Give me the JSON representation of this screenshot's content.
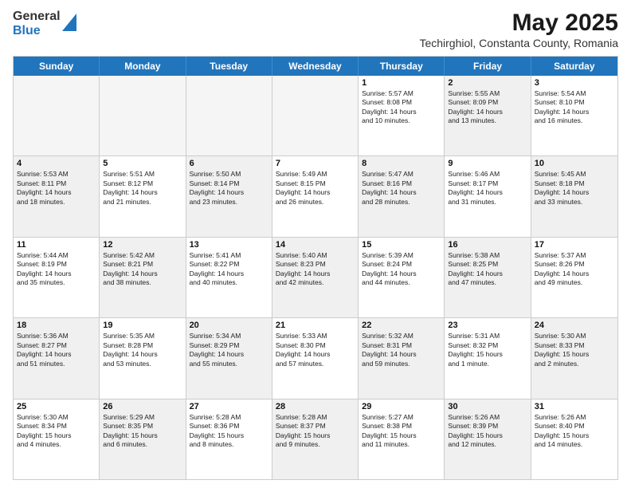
{
  "header": {
    "logo_line1": "General",
    "logo_line2": "Blue",
    "month_year": "May 2025",
    "location": "Techirghiol, Constanta County, Romania"
  },
  "days_of_week": [
    "Sunday",
    "Monday",
    "Tuesday",
    "Wednesday",
    "Thursday",
    "Friday",
    "Saturday"
  ],
  "weeks": [
    [
      {
        "day": "",
        "text": "",
        "empty": true
      },
      {
        "day": "",
        "text": "",
        "empty": true
      },
      {
        "day": "",
        "text": "",
        "empty": true
      },
      {
        "day": "",
        "text": "",
        "empty": true
      },
      {
        "day": "1",
        "text": "Sunrise: 5:57 AM\nSunset: 8:08 PM\nDaylight: 14 hours\nand 10 minutes.",
        "empty": false
      },
      {
        "day": "2",
        "text": "Sunrise: 5:55 AM\nSunset: 8:09 PM\nDaylight: 14 hours\nand 13 minutes.",
        "empty": false,
        "shaded": true
      },
      {
        "day": "3",
        "text": "Sunrise: 5:54 AM\nSunset: 8:10 PM\nDaylight: 14 hours\nand 16 minutes.",
        "empty": false
      }
    ],
    [
      {
        "day": "4",
        "text": "Sunrise: 5:53 AM\nSunset: 8:11 PM\nDaylight: 14 hours\nand 18 minutes.",
        "empty": false,
        "shaded": true
      },
      {
        "day": "5",
        "text": "Sunrise: 5:51 AM\nSunset: 8:12 PM\nDaylight: 14 hours\nand 21 minutes.",
        "empty": false
      },
      {
        "day": "6",
        "text": "Sunrise: 5:50 AM\nSunset: 8:14 PM\nDaylight: 14 hours\nand 23 minutes.",
        "empty": false,
        "shaded": true
      },
      {
        "day": "7",
        "text": "Sunrise: 5:49 AM\nSunset: 8:15 PM\nDaylight: 14 hours\nand 26 minutes.",
        "empty": false
      },
      {
        "day": "8",
        "text": "Sunrise: 5:47 AM\nSunset: 8:16 PM\nDaylight: 14 hours\nand 28 minutes.",
        "empty": false,
        "shaded": true
      },
      {
        "day": "9",
        "text": "Sunrise: 5:46 AM\nSunset: 8:17 PM\nDaylight: 14 hours\nand 31 minutes.",
        "empty": false
      },
      {
        "day": "10",
        "text": "Sunrise: 5:45 AM\nSunset: 8:18 PM\nDaylight: 14 hours\nand 33 minutes.",
        "empty": false,
        "shaded": true
      }
    ],
    [
      {
        "day": "11",
        "text": "Sunrise: 5:44 AM\nSunset: 8:19 PM\nDaylight: 14 hours\nand 35 minutes.",
        "empty": false
      },
      {
        "day": "12",
        "text": "Sunrise: 5:42 AM\nSunset: 8:21 PM\nDaylight: 14 hours\nand 38 minutes.",
        "empty": false,
        "shaded": true
      },
      {
        "day": "13",
        "text": "Sunrise: 5:41 AM\nSunset: 8:22 PM\nDaylight: 14 hours\nand 40 minutes.",
        "empty": false
      },
      {
        "day": "14",
        "text": "Sunrise: 5:40 AM\nSunset: 8:23 PM\nDaylight: 14 hours\nand 42 minutes.",
        "empty": false,
        "shaded": true
      },
      {
        "day": "15",
        "text": "Sunrise: 5:39 AM\nSunset: 8:24 PM\nDaylight: 14 hours\nand 44 minutes.",
        "empty": false
      },
      {
        "day": "16",
        "text": "Sunrise: 5:38 AM\nSunset: 8:25 PM\nDaylight: 14 hours\nand 47 minutes.",
        "empty": false,
        "shaded": true
      },
      {
        "day": "17",
        "text": "Sunrise: 5:37 AM\nSunset: 8:26 PM\nDaylight: 14 hours\nand 49 minutes.",
        "empty": false
      }
    ],
    [
      {
        "day": "18",
        "text": "Sunrise: 5:36 AM\nSunset: 8:27 PM\nDaylight: 14 hours\nand 51 minutes.",
        "empty": false,
        "shaded": true
      },
      {
        "day": "19",
        "text": "Sunrise: 5:35 AM\nSunset: 8:28 PM\nDaylight: 14 hours\nand 53 minutes.",
        "empty": false
      },
      {
        "day": "20",
        "text": "Sunrise: 5:34 AM\nSunset: 8:29 PM\nDaylight: 14 hours\nand 55 minutes.",
        "empty": false,
        "shaded": true
      },
      {
        "day": "21",
        "text": "Sunrise: 5:33 AM\nSunset: 8:30 PM\nDaylight: 14 hours\nand 57 minutes.",
        "empty": false
      },
      {
        "day": "22",
        "text": "Sunrise: 5:32 AM\nSunset: 8:31 PM\nDaylight: 14 hours\nand 59 minutes.",
        "empty": false,
        "shaded": true
      },
      {
        "day": "23",
        "text": "Sunrise: 5:31 AM\nSunset: 8:32 PM\nDaylight: 15 hours\nand 1 minute.",
        "empty": false
      },
      {
        "day": "24",
        "text": "Sunrise: 5:30 AM\nSunset: 8:33 PM\nDaylight: 15 hours\nand 2 minutes.",
        "empty": false,
        "shaded": true
      }
    ],
    [
      {
        "day": "25",
        "text": "Sunrise: 5:30 AM\nSunset: 8:34 PM\nDaylight: 15 hours\nand 4 minutes.",
        "empty": false
      },
      {
        "day": "26",
        "text": "Sunrise: 5:29 AM\nSunset: 8:35 PM\nDaylight: 15 hours\nand 6 minutes.",
        "empty": false,
        "shaded": true
      },
      {
        "day": "27",
        "text": "Sunrise: 5:28 AM\nSunset: 8:36 PM\nDaylight: 15 hours\nand 8 minutes.",
        "empty": false
      },
      {
        "day": "28",
        "text": "Sunrise: 5:28 AM\nSunset: 8:37 PM\nDaylight: 15 hours\nand 9 minutes.",
        "empty": false,
        "shaded": true
      },
      {
        "day": "29",
        "text": "Sunrise: 5:27 AM\nSunset: 8:38 PM\nDaylight: 15 hours\nand 11 minutes.",
        "empty": false
      },
      {
        "day": "30",
        "text": "Sunrise: 5:26 AM\nSunset: 8:39 PM\nDaylight: 15 hours\nand 12 minutes.",
        "empty": false,
        "shaded": true
      },
      {
        "day": "31",
        "text": "Sunrise: 5:26 AM\nSunset: 8:40 PM\nDaylight: 15 hours\nand 14 minutes.",
        "empty": false
      }
    ]
  ]
}
